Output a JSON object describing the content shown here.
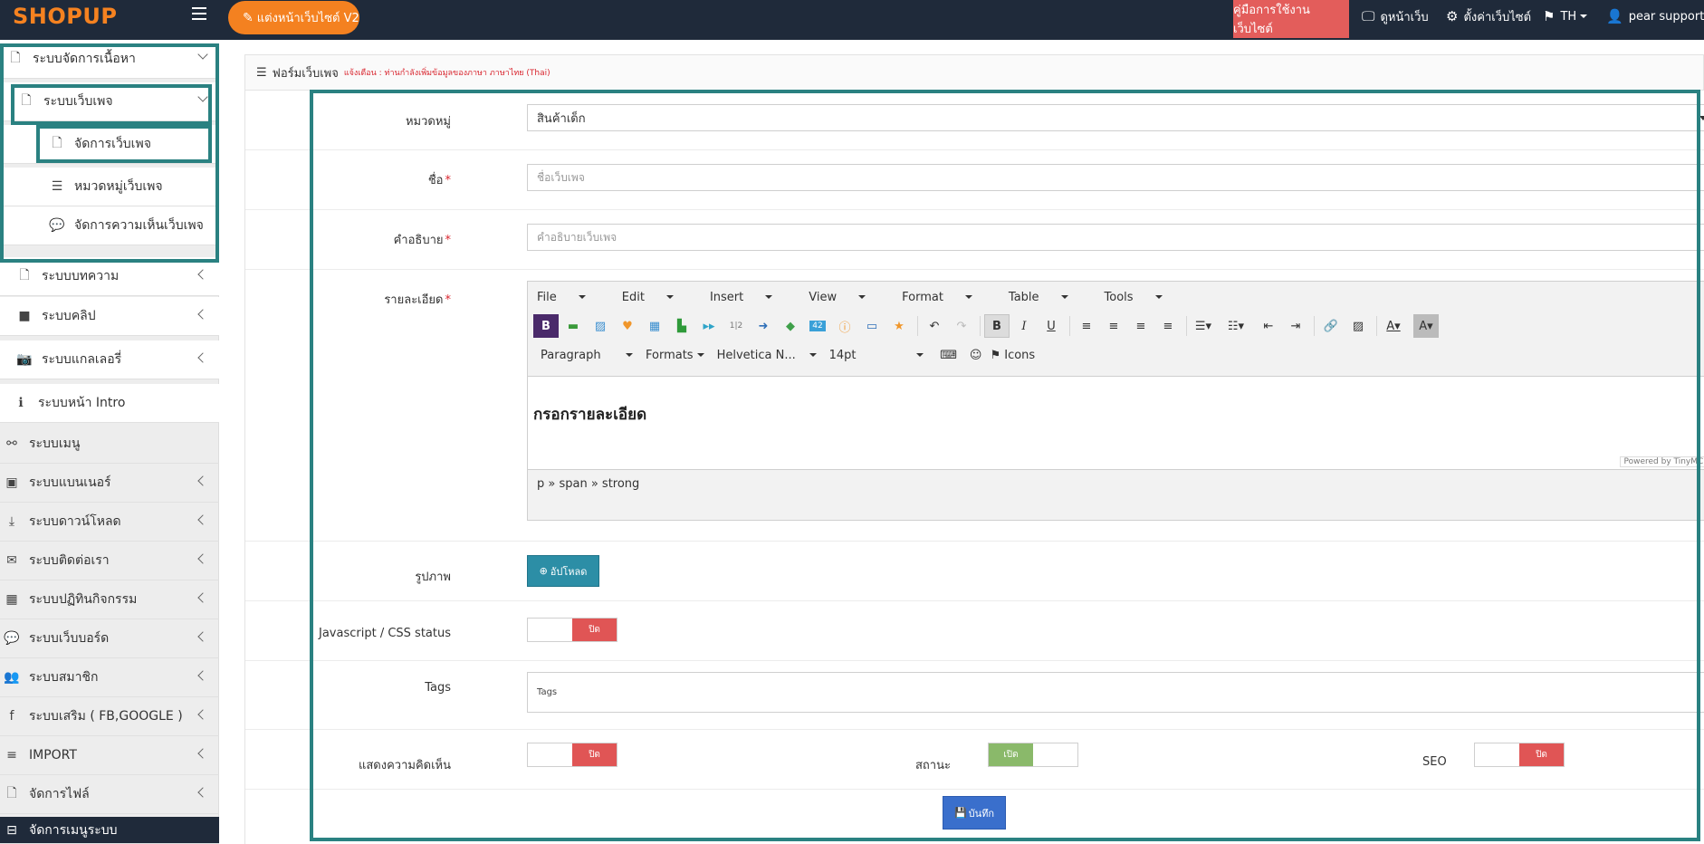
{
  "topbar": {
    "logo": "SHOPUP",
    "v2_button": "แต่งหน้าเว็บไซต์ V2",
    "guide_button": "คู่มือการใช้งานเว็บไซต์",
    "view_site": "ดูหน้าเว็บ",
    "settings": "ตั้งค่าเว็บไซต์",
    "language": "TH",
    "user": "pear support"
  },
  "sidebar": {
    "items": [
      {
        "label": "ระบบจัดการเนื้อหา"
      },
      {
        "label": "ระบบเว็บเพจ"
      },
      {
        "label": "จัดการเว็บเพจ"
      },
      {
        "label": "หมวดหมู่เว็บเพจ"
      },
      {
        "label": "จัดการความเห็นเว็บเพจ"
      },
      {
        "label": "ระบบบทความ"
      },
      {
        "label": "ระบบคลิป"
      },
      {
        "label": "ระบบแกลเลอรี่"
      },
      {
        "label": "ระบบหน้า Intro"
      },
      {
        "label": "ระบบเมนู"
      },
      {
        "label": "ระบบแบนเนอร์"
      },
      {
        "label": "ระบบดาวน์โหลด"
      },
      {
        "label": "ระบบติดต่อเรา"
      },
      {
        "label": "ระบบปฏิทินกิจกรรม"
      },
      {
        "label": "ระบบเว็บบอร์ด"
      },
      {
        "label": "ระบบสมาชิก"
      },
      {
        "label": "ระบบเสริม ( FB,GOOGLE )"
      },
      {
        "label": "IMPORT"
      },
      {
        "label": "จัดการไฟล์"
      },
      {
        "label": "จัดการเมนูระบบ"
      }
    ]
  },
  "form": {
    "title": "ฟอร์มเว็บเพจ",
    "warning": "แจ้งเตือน : ท่านกำลังเพิ่มข้อมูลของภาษา ภาษาไทย (Thai)",
    "category_label": "หมวดหมู่",
    "category_value": "สินค้าเด็ก",
    "name_label": "ชื่อ",
    "name_placeholder": "ชื่อเว็บเพจ",
    "desc_label": "คำอธิบาย",
    "desc_placeholder": "คำอธิบายเว็บเพจ",
    "detail_label": "รายละเอียด",
    "required_mark": "*",
    "image_label": "รูปภาพ",
    "upload_button": "อัปโหลด",
    "js_label": "Javascript / CSS status",
    "js_toggle": "ปิด",
    "tags_label": "Tags",
    "tags_placeholder": "Tags",
    "comments_label": "แสดงความคิดเห็น",
    "comments_toggle": "ปิด",
    "status_label": "สถานะ",
    "status_toggle": "เปิด",
    "seo_label": "SEO",
    "seo_toggle": "ปิด",
    "save_button": "บันทึก"
  },
  "editor": {
    "menus": [
      "File",
      "Edit",
      "Insert",
      "View",
      "Format",
      "Table",
      "Tools"
    ],
    "block_format": "Paragraph",
    "formats": "Formats",
    "font_family": "Helvetica N...",
    "font_size": "14pt",
    "icons_button": "Icons",
    "content": "กรอกรายละเอียด",
    "powered_by": "Powered by TinyMCE",
    "path": "p » span » strong"
  },
  "colors": {
    "topbar": "#1f2a3a",
    "accent_orange": "#f48120",
    "guide_red": "#e35d5b",
    "highlight_teal": "#2a8181",
    "toggle_off": "#e05555",
    "toggle_on": "#8ab96a",
    "upload": "#2c8ea6",
    "save": "#3a6fcc"
  }
}
